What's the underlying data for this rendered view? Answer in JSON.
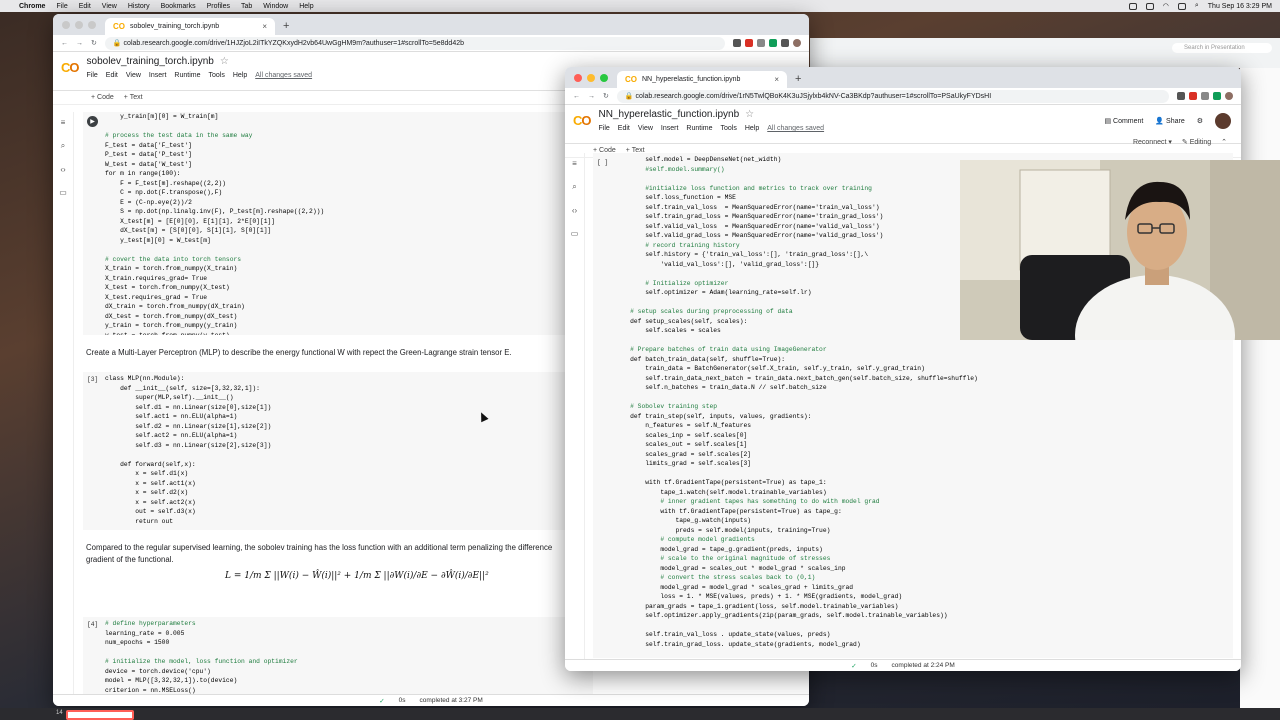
{
  "menubar": {
    "app": "Chrome",
    "items": [
      "File",
      "Edit",
      "View",
      "History",
      "Bookmarks",
      "Profiles",
      "Tab",
      "Window",
      "Help"
    ],
    "clock": "Thu Sep 16  3:29 PM"
  },
  "left_window": {
    "tab_title": "sobolev_training_torch.ipynb",
    "url": "colab.research.google.com/drive/1HJZjoL2iITkYZQKxydH2vb64UwGgHM9m?authuser=1#scrollTo=5e8dd42b",
    "notebook_title": "sobolev_training_torch.ipynb",
    "menu": [
      "File",
      "Edit",
      "View",
      "Insert",
      "Runtime",
      "Tools",
      "Help"
    ],
    "saved": "All changes saved",
    "toolbar": {
      "code": "+ Code",
      "text": "+ Text"
    },
    "cell1_lines": [
      "    y_train[m][0] = W_train[m]",
      "",
      "# process the test data in the same way",
      "F_test = data['F_test']",
      "P_test = data['P_test']",
      "W_test = data['W_test']",
      "for m in range(100):",
      "    F = F_test[m].reshape((2,2))",
      "    C = np.dot(F.transpose(),F)",
      "    E = (C-np.eye(2))/2",
      "    S = np.dot(np.linalg.inv(F), P_test[m].reshape((2,2)))",
      "    X_test[m] = [E[0][0], E[1][1], 2*E[0][1]]",
      "    dX_test[m] = [S[0][0], S[1][1], S[0][1]]",
      "    y_test[m][0] = W_test[m]",
      "",
      "# covert the data into torch tensors",
      "X_train = torch.from_numpy(X_train)",
      "X_train.requires_grad= True",
      "X_test = torch.from_numpy(X_test)",
      "X_test.requires_grad = True",
      "dX_train = torch.from_numpy(dX_train)",
      "dX_test = torch.from_numpy(dX_test)",
      "y_train = torch.from_numpy(y_train)",
      "y_test = torch.from_numpy(y_test)"
    ],
    "text1": "Create a Multi-Layer Perceptron (MLP) to describe the energy functional W with repect the Green-Lagrange strain tensor E.",
    "cell2_num": "[3]",
    "cell2_lines": [
      "class MLP(nn.Module):",
      "    def __init__(self, size=[3,32,32,1]):",
      "        super(MLP,self).__init__()",
      "        self.d1 = nn.Linear(size[0],size[1])",
      "        self.act1 = nn.ELU(alpha=1)",
      "        self.d2 = nn.Linear(size[1],size[2])",
      "        self.act2 = nn.ELU(alpha=1)",
      "        self.d3 = nn.Linear(size[2],size[3])",
      "",
      "    def forward(self,x):",
      "        x = self.d1(x)",
      "        x = self.act1(x)",
      "        x = self.d2(x)",
      "        x = self.act2(x)",
      "        out = self.d3(x)",
      "        return out"
    ],
    "text2_line1": "Compared to the regular supervised learning, the sobolev training has the loss function with an additional term penalizing the difference",
    "text2_line2": "gradient of the functional.",
    "formula": "L = 1/m Σ ||W(i) − Ŵ(i)||² + 1/m Σ ||∂W(i)/∂E − ∂Ŵ(i)/∂E||²",
    "cell3_num": "[4]",
    "cell3_lines": [
      "# define hyperparameters",
      "learning_rate = 0.005",
      "num_epochs = 1500",
      "",
      "# initialize the model, loss function and optimizer",
      "device = torch.device('cpu')",
      "model = MLP([3,32,32,1]).to(device)",
      "criterion = nn.MSELoss()"
    ],
    "status_secs": "0s",
    "status_text": "completed at 3:27 PM"
  },
  "right_window": {
    "tab_title": "NN_hyperelastic_function.ipynb",
    "url": "colab.research.google.com/drive/1rN5TwlQBoK4K3uJSjylxb4kNV-Ca3BKdp?authuser=1#scrollTo=PSaUkyFYDsHI",
    "notebook_title": "NN_hyperelastic_function.ipynb",
    "menu": [
      "File",
      "Edit",
      "View",
      "Insert",
      "Runtime",
      "Tools",
      "Help"
    ],
    "saved": "All changes saved",
    "comment": "Comment",
    "share": "Share",
    "toolbar": {
      "code": "+ Code",
      "text": "+ Text",
      "reconnect": "Reconnect",
      "editing": "Editing"
    },
    "cell_num": "[ ]",
    "code_lines": [
      "        self.model = DeepDenseNet(net_width)",
      "        #self.model.summary()",
      "",
      "        #initialize loss function and metrics to track over training",
      "        self.loss_function = MSE",
      "        self.train_val_loss  = MeanSquaredError(name='train_val_loss')",
      "        self.train_grad_loss = MeanSquaredError(name='train_grad_loss')",
      "        self.valid_val_loss  = MeanSquaredError(name='valid_val_loss')",
      "        self.valid_grad_loss = MeanSquaredError(name='valid_grad_loss')",
      "        # record training history",
      "        self.history = {'train_val_loss':[], 'train_grad_loss':[],\\",
      "            'valid_val_loss':[], 'valid_grad_loss':[]}",
      "",
      "        # Initialize optimizer",
      "        self.optimizer = Adam(learning_rate=self.lr)",
      "",
      "    # setup scales during preprocessing of data",
      "    def setup_scales(self, scales):",
      "        self.scales = scales",
      "",
      "    # Prepare batches of train data using ImageGenerator",
      "    def batch_train_data(self, shuffle=True):",
      "        train_data = BatchGenerator(self.X_train, self.y_train, self.y_grad_train)",
      "        self.train_data_next_batch = train_data.next_batch_gen(self.batch_size, shuffle=shuffle)",
      "        self.n_batches = train_data.N // self.batch_size",
      "",
      "    # Sobolev training step",
      "    def train_step(self, inputs, values, gradients):",
      "        n_features = self.N_features",
      "        scales_inp = self.scales[0]",
      "        scales_out = self.scales[1]",
      "        scales_grad = self.scales[2]",
      "        limits_grad = self.scales[3]",
      "",
      "        with tf.GradientTape(persistent=True) as tape_1:",
      "            tape_1.watch(self.model.trainable_variables)",
      "            # inner gradient tapes has something to do with model grad",
      "            with tf.GradientTape(persistent=True) as tape_g:",
      "                tape_g.watch(inputs)",
      "                preds = self.model(inputs, training=True)",
      "            # compute model gradients",
      "            model_grad = tape_g.gradient(preds, inputs)",
      "            # scale to the original magnitude of stresses",
      "            model_grad = scales_out * model_grad * scales_inp",
      "            # convert the stress scales back to (0,1)",
      "            model_grad = model_grad * scales_grad + limits_grad",
      "            loss = 1. * MSE(values, preds) + 1. * MSE(gradients, model_grad)",
      "        param_grads = tape_1.gradient(loss, self.model.trainable_variables)",
      "        self.optimizer.apply_gradients(zip(param_grads, self.model.trainable_variables))",
      "",
      "        self.train_val_loss . update_state(values, preds)",
      "        self.train_grad_loss. update_state(gradients, model_grad)"
    ],
    "status_secs": "0s",
    "status_text": "completed at 2:24 PM"
  },
  "background": {
    "search_placeholder": "Search in Presentation"
  },
  "dock": {
    "badge": "14"
  }
}
